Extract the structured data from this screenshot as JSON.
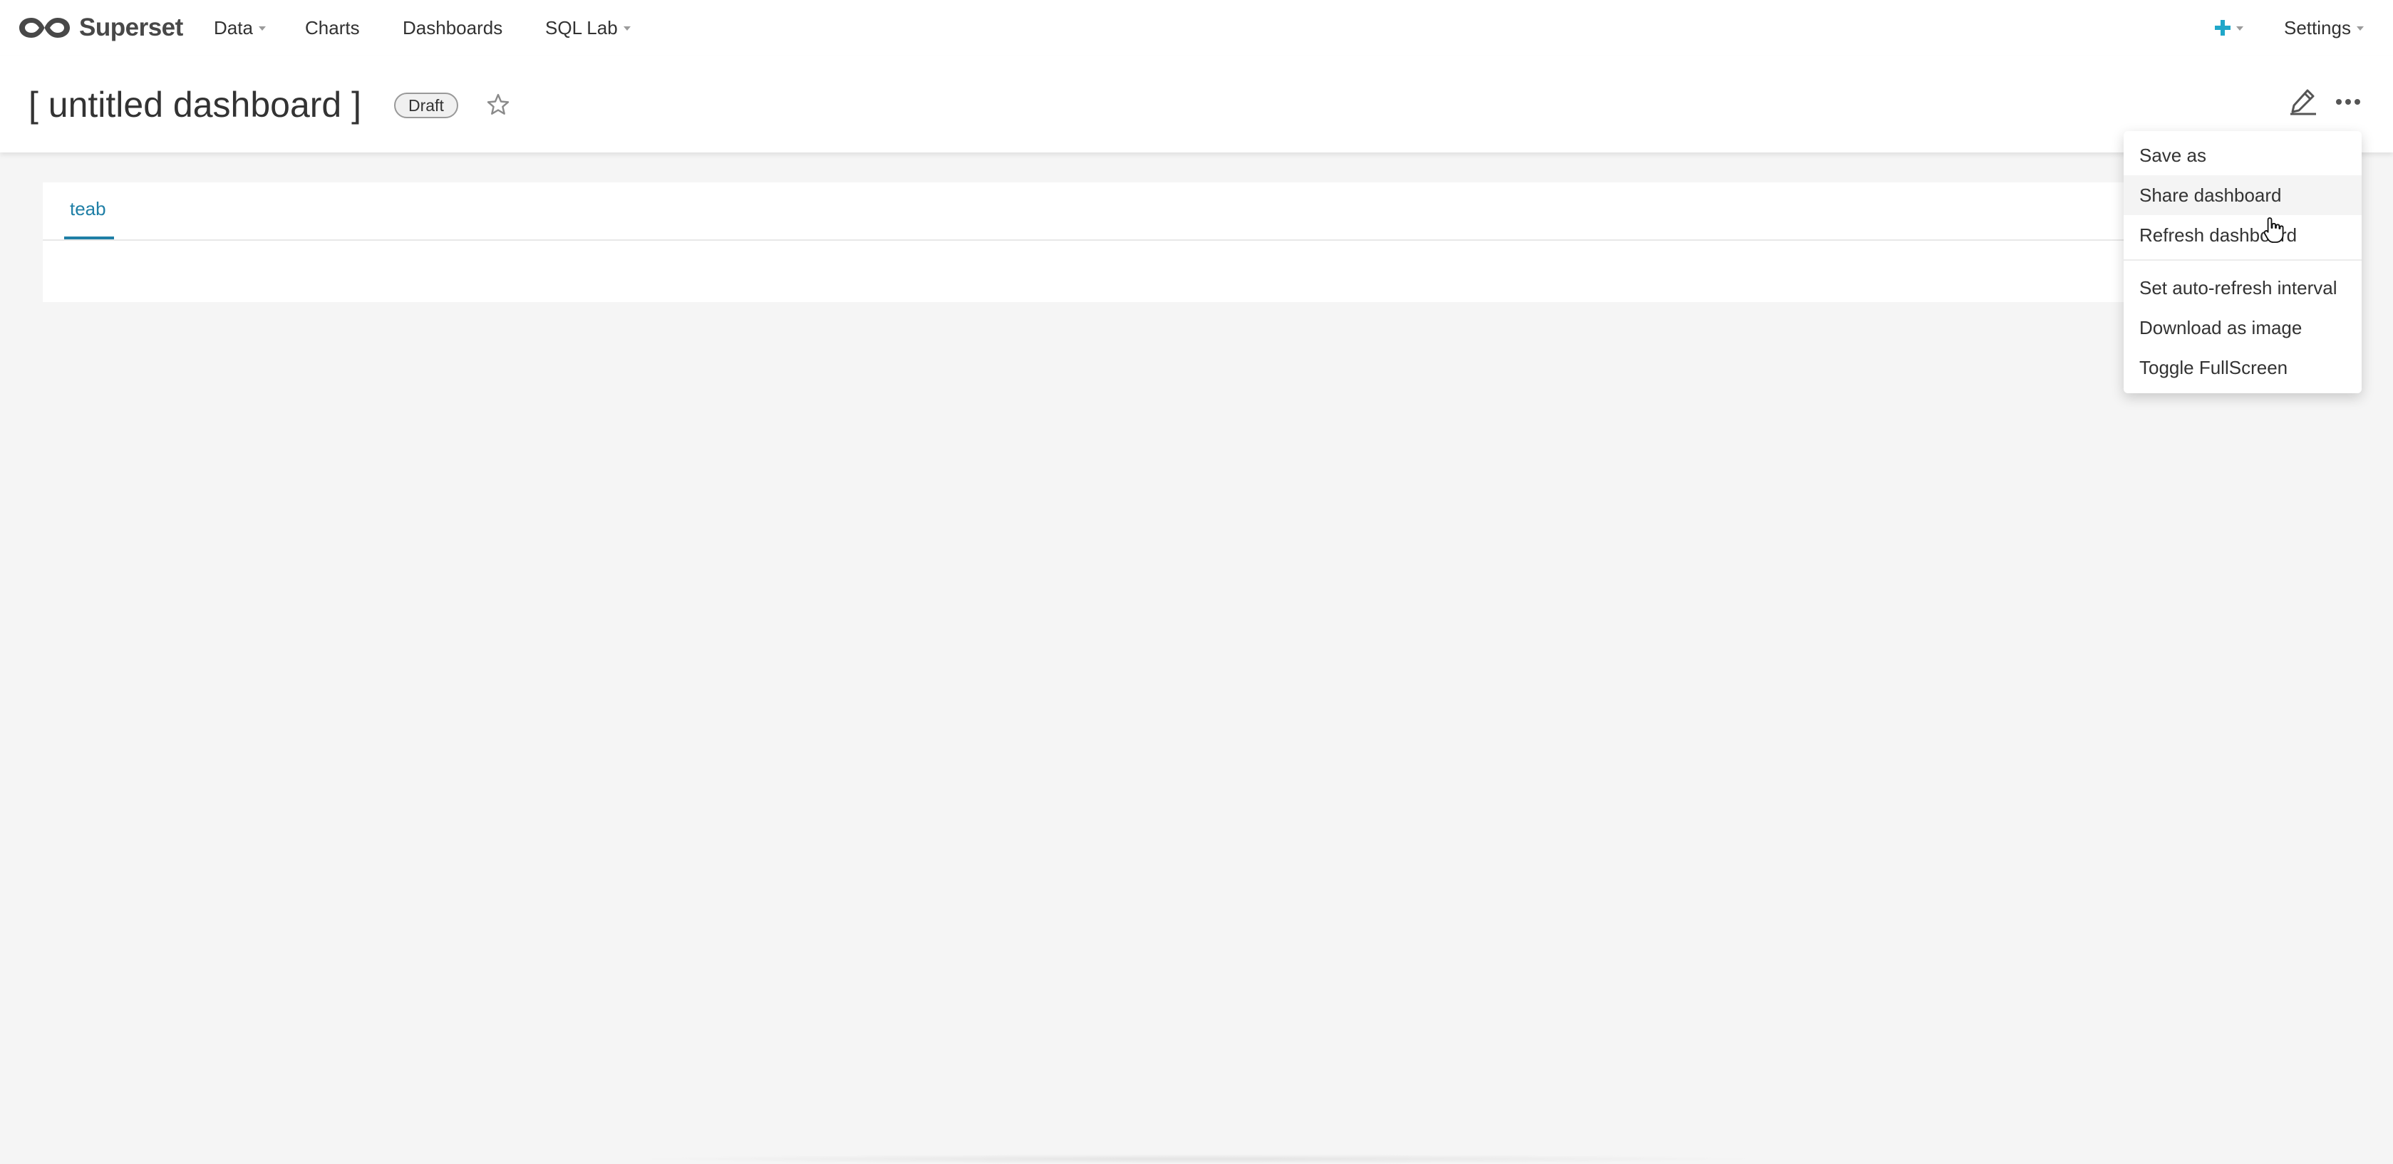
{
  "brand": {
    "name": "Superset"
  },
  "nav": {
    "data_label": "Data",
    "charts_label": "Charts",
    "dashboards_label": "Dashboards",
    "sqllab_label": "SQL Lab",
    "settings_label": "Settings"
  },
  "dashboard": {
    "title": "[ untitled dashboard ]",
    "status_badge": "Draft"
  },
  "tabs": [
    {
      "label": "teab",
      "active": true
    }
  ],
  "menu": {
    "items": [
      "Save as",
      "Share dashboard",
      "Refresh dashboard",
      "Set auto-refresh interval",
      "Download as image",
      "Toggle FullScreen"
    ],
    "hovered_item": "Share dashboard"
  },
  "colors": {
    "accent": "#1f7fa6",
    "plus_icon": "#20a7c9",
    "background": "#f5f5f5"
  },
  "icons": [
    "superset-logo-icon",
    "plus-icon",
    "star-icon",
    "pencil-icon",
    "more-horizontal-icon",
    "pointer-cursor-icon"
  ]
}
